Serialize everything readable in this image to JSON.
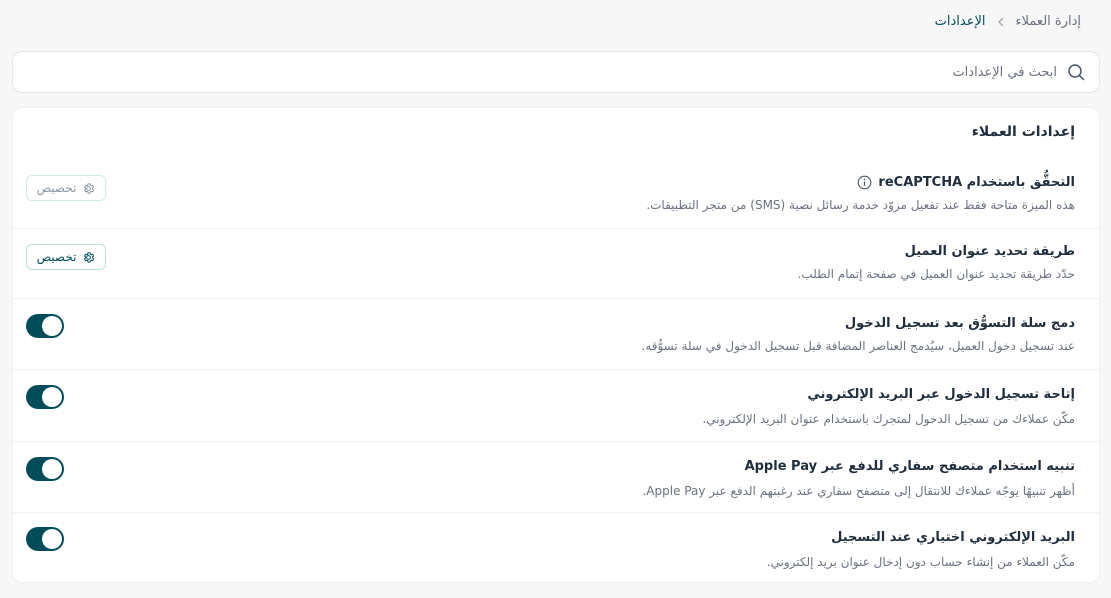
{
  "breadcrumb": {
    "parent": "إدارة العملاء",
    "current": "الإعدادات"
  },
  "search": {
    "placeholder": "ابحث في الإعدادات"
  },
  "section": {
    "title": "إعدادات العملاء"
  },
  "settings": [
    {
      "title": "التحقُّق باستخدام reCAPTCHA",
      "description": "هذه الميزة متاحة فقط عند تفعيل مزوّد خدمة رسائل نصية (SMS) من متجر التطبيقات.",
      "action": "button",
      "action_label": "تخصيص",
      "enabled": false
    },
    {
      "title": "طريقة تحديد عنوان العميل",
      "description": "حدّد طريقة تحديد عنوان العميل في صفحة إتمام الطلب.",
      "action": "button",
      "action_label": "تخصيص",
      "enabled": true
    },
    {
      "title": "دمج سلة التسوُّق بعد تسجيل الدخول",
      "description": "عند تسجيل دخول العميل، سيُدمج العناصر المضافة قبل تسجيل الدخول في سلة تسوُّقه.",
      "action": "toggle",
      "on": true
    },
    {
      "title": "إتاحة تسجيل الدخول عبر البريد الإلكتروني",
      "description": "مكّن عملاءك من تسجيل الدخول لمتجرك باستخدام عنوان البريد الإلكتروني.",
      "action": "toggle",
      "on": true
    },
    {
      "title": "تنبيه استخدام متصفح سفاري للدفع عبر Apple Pay",
      "description": "أظهر تنبيهًا يوجّه عملاءك للانتقال إلى متصفح سفاري عند رغبتهم الدفع عبر Apple Pay.",
      "action": "toggle",
      "on": true
    },
    {
      "title": "البريد الإلكتروني اختياري عند التسجيل",
      "description": "مكّن العملاء من إنشاء حساب دون إدخال عنوان بريد إلكتروني.",
      "action": "toggle",
      "on": true
    }
  ],
  "colors": {
    "accent": "#004d5a",
    "button_border": "#b9e0df",
    "background": "#f7f7f8"
  },
  "icons": {
    "search": "search-icon",
    "info": "info-icon",
    "gear": "gear-icon",
    "chevron": "chevron-left-icon"
  }
}
